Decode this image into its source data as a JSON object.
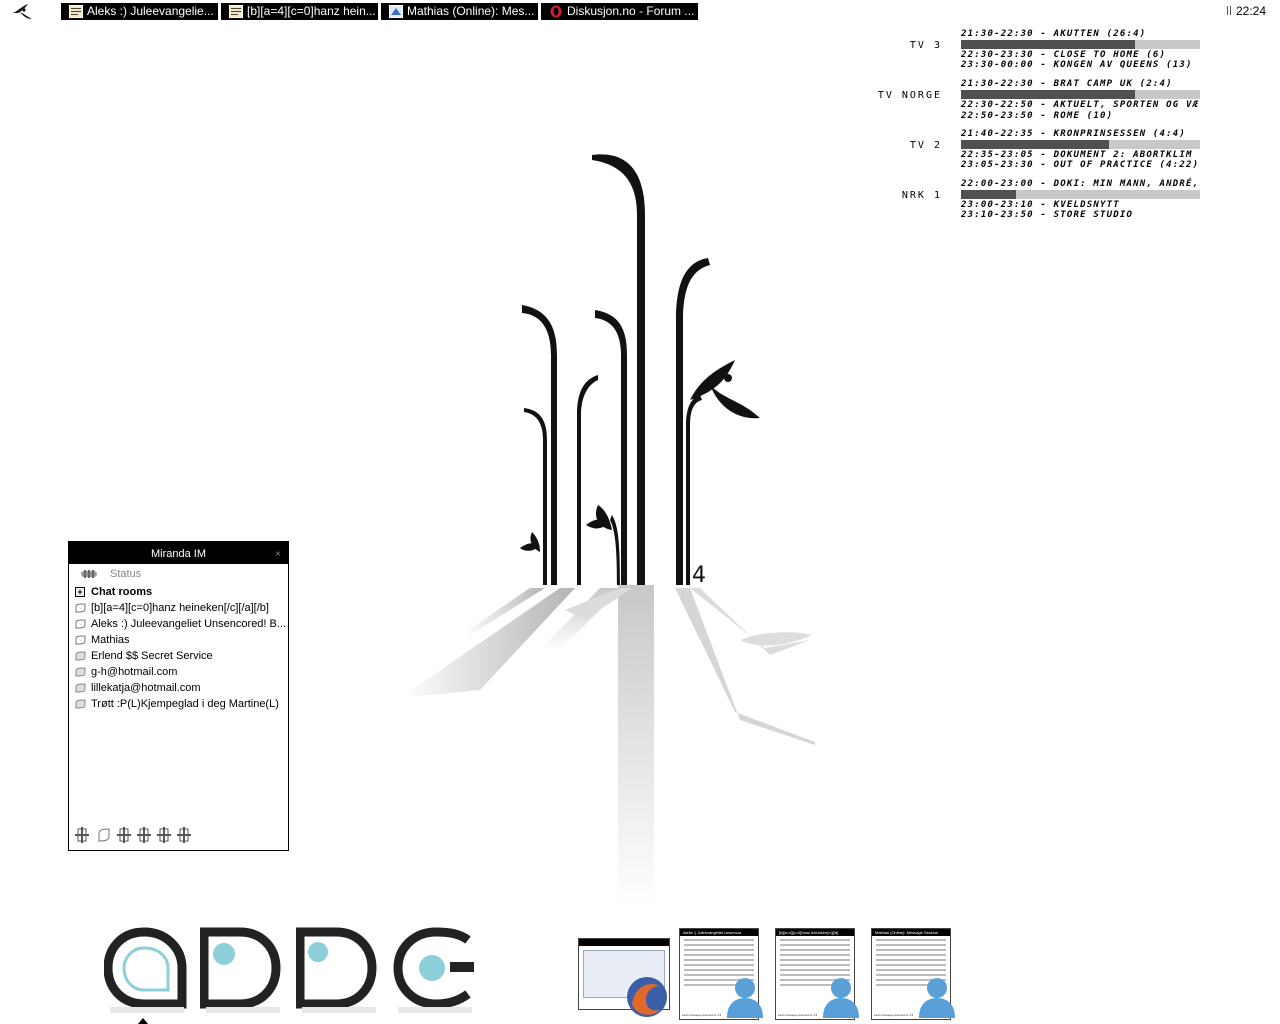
{
  "taskbar": {
    "tasks": [
      {
        "label": "Aleks :) Juleevangelie...",
        "icon": "chat-window-icon"
      },
      {
        "label": "[b][a=4][c=0]hanz hein...",
        "icon": "chat-window-icon"
      },
      {
        "label": "Mathias (Online): Mes...",
        "icon": "messenger-icon"
      },
      {
        "label": "Diskusjon.no - Forum ...",
        "icon": "opera-icon"
      }
    ],
    "clock": "22:24"
  },
  "tvguide": {
    "channels": [
      {
        "name": "TV 3",
        "programs": [
          "21:30-22:30 - Akutten (26:4)",
          "22:30-23:30 - Close to Home (6)",
          "23:30-00:00 - Kongen av Queens (13)"
        ],
        "progress": 0.73
      },
      {
        "name": "TV Norge",
        "programs": [
          "21:30-22:30 - Brat Camp UK (2:4)",
          "22:30-22:50 - Aktuelt, sporten og væ",
          "22:50-23:50 - Rome (10)"
        ],
        "progress": 0.73
      },
      {
        "name": "TV 2",
        "programs": [
          "21:40-22:35 - Kronprinsessen (4:4)",
          "22:35-23:05 - Dokument 2: Abortkliμ",
          "23:05-23:30 - Out of Practice (4:22)"
        ],
        "progress": 0.62
      },
      {
        "name": "NRK 1",
        "programs": [
          "22:00-23:00 - Doki: Min mann, André,",
          "23:00-23:10 - Kveldsnytt",
          "23:10-23:50 - Store Studio"
        ],
        "progress": 0.23
      }
    ]
  },
  "miranda": {
    "title": "Miranda IM",
    "close": "×",
    "status": "Status",
    "group": "Chat rooms",
    "contacts": [
      "[b][a=4][c=0]hanz heineken[/c][/a][/b]",
      "Aleks :) Juleevangeliet Unsencored! B...",
      "Mathias",
      "Erlend $$ Secret Service",
      "g-h@hotmail.com",
      "lillekatja@hotmail.com",
      "Trøtt :P(L)Kjempeglad i deg Martine(L)"
    ]
  },
  "wallpaper": {
    "number": "4"
  },
  "dock": {
    "letters": [
      "a",
      "b",
      "b",
      "c"
    ],
    "accent": "#8ccfd8"
  },
  "thumbnails": [
    {
      "title": "",
      "footer": ""
    },
    {
      "title": "Aleks :) Juleevangeliet Unsencor",
      "footer": "Last message received on 13"
    },
    {
      "title": "[b][a=4][c=0]hanz heineken[/c][/a]",
      "footer": "Last message received on 13"
    },
    {
      "title": "Mathias (Online): Message Session",
      "footer": "Last message received on 13"
    }
  ]
}
